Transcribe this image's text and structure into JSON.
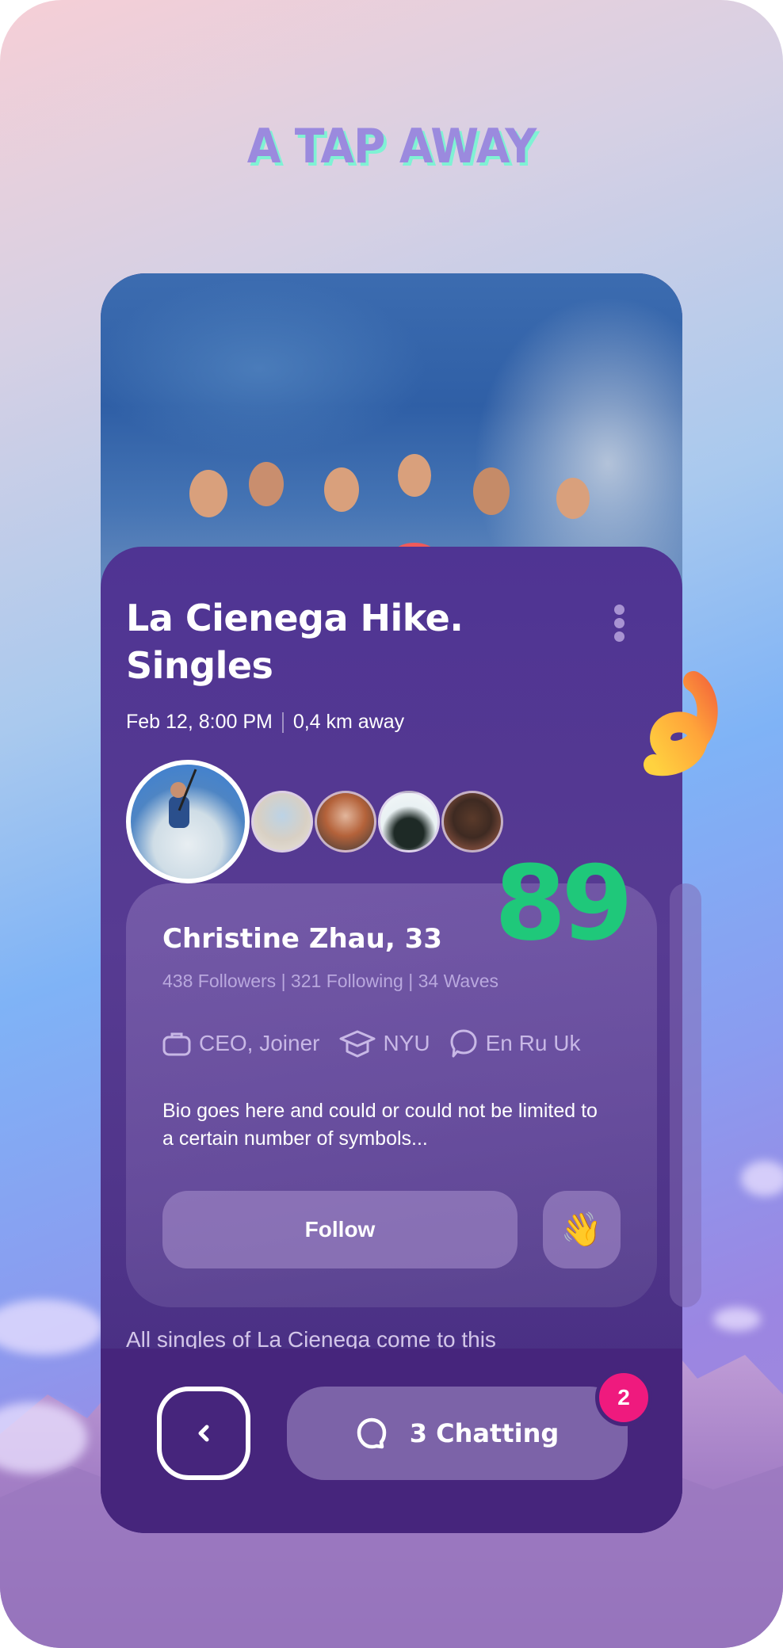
{
  "headline": "A TAP AWAY",
  "event": {
    "title_line1": "La Cienega Hike.",
    "title_line2": "Singles",
    "date_time": "Feb 12, 8:00 PM",
    "distance": "0,4 km away",
    "more_icon": "more-vertical-icon",
    "description_preview": "All singles of La Cienega come to this"
  },
  "participants": {
    "featured": "wakeboarding-participant-avatar",
    "others": [
      "participant-avatar-2",
      "participant-avatar-3",
      "participant-avatar-4",
      "participant-avatar-5"
    ]
  },
  "match_score": "89",
  "profile": {
    "name": "Christine Zhau, 33",
    "stats": "438 Followers | 321 Following | 34 Waves",
    "tags": [
      {
        "icon": "briefcase-icon",
        "label": "CEO, Joiner"
      },
      {
        "icon": "graduation-cap-icon",
        "label": "NYU"
      },
      {
        "icon": "speech-bubble-icon",
        "label": "En Ru Uk"
      }
    ],
    "bio": "Bio goes here and could or could not be limited to a certain number of symbols...",
    "follow_label": "Follow",
    "wave_emoji": "👋"
  },
  "bottom_bar": {
    "back_icon": "chevron-left-icon",
    "chat_label": "3 Chatting",
    "chat_icon": "chat-bubble-icon",
    "badge_count": "2"
  },
  "colors": {
    "score": "#1fc87a",
    "badge": "#ef1a7e",
    "card": "#4a2e86",
    "bottom_bar": "#46257c",
    "headline": "#9b8ade",
    "headline_shadow": "#7ff2d4"
  }
}
